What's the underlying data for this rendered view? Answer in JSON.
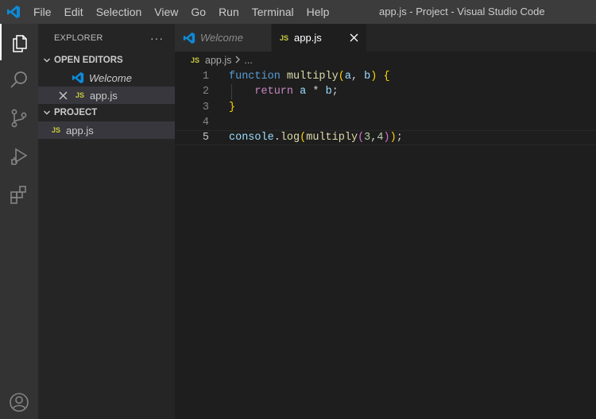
{
  "window": {
    "title": "app.js - Project - Visual Studio Code"
  },
  "menu": [
    "File",
    "Edit",
    "Selection",
    "View",
    "Go",
    "Run",
    "Terminal",
    "Help"
  ],
  "activity_bar": [
    "explorer-icon",
    "search-icon",
    "source-control-icon",
    "run-debug-icon",
    "extensions-icon",
    "accounts-icon"
  ],
  "sidebar": {
    "title": "EXPLORER",
    "more": "···",
    "open_editors": {
      "label": "OPEN EDITORS",
      "items": [
        {
          "name": "Welcome",
          "icon": "vscode-icon"
        },
        {
          "name": "app.js",
          "badge": "JS"
        }
      ]
    },
    "project": {
      "label": "PROJECT",
      "items": [
        {
          "name": "app.js",
          "badge": "JS"
        }
      ]
    }
  },
  "tabs": [
    {
      "label": "Welcome",
      "active": false
    },
    {
      "label": "app.js",
      "badge": "JS",
      "active": true
    }
  ],
  "breadcrumb": {
    "badge": "JS",
    "file": "app.js",
    "rest": "..."
  },
  "code": {
    "line_numbers": [
      "1",
      "2",
      "3",
      "4",
      "5"
    ],
    "current_line": "5",
    "lines": [
      "function multiply(a, b) {",
      "    return a * b;",
      "}",
      "",
      "console.log(multiply(3,4));"
    ]
  },
  "colors": {
    "accent_vscode": "#0e8ad8",
    "js_badge": "#cbcb41"
  }
}
